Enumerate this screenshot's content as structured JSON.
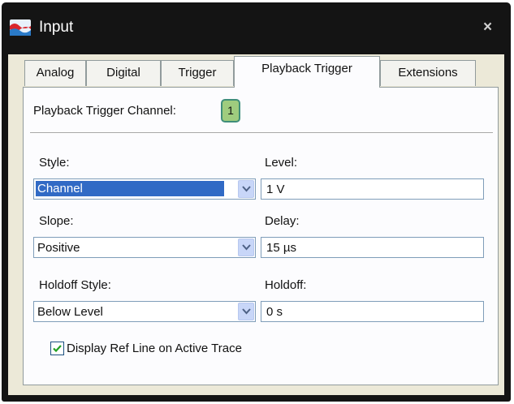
{
  "window": {
    "title": "Input",
    "close_glyph": "×"
  },
  "tabs": [
    {
      "label": "Analog"
    },
    {
      "label": "Digital"
    },
    {
      "label": "Trigger"
    },
    {
      "label": "Playback Trigger"
    },
    {
      "label": "Extensions"
    }
  ],
  "active_tab": "Playback Trigger",
  "playback_trigger": {
    "channel_label": "Playback Trigger Channel:",
    "channel_value": "1",
    "style": {
      "label": "Style:",
      "value": "Channel"
    },
    "level": {
      "label": "Level:",
      "value": "1 V"
    },
    "slope": {
      "label": "Slope:",
      "value": "Positive"
    },
    "delay": {
      "label": "Delay:",
      "value": "15 µs"
    },
    "holdoff_style": {
      "label": "Holdoff Style:",
      "value": "Below Level"
    },
    "holdoff": {
      "label": "Holdoff:",
      "value": "0 s"
    },
    "ref_line": {
      "label": "Display Ref Line on Active Trace",
      "checked": true
    }
  },
  "colors": {
    "selection": "#316ac5",
    "channel_badge": "#9fcc7e",
    "titlebar": "#141414"
  },
  "icons": {
    "app": "app-logo-icon",
    "close": "close-icon",
    "dropdown": "chevron-down-icon",
    "check": "checkmark-icon"
  }
}
